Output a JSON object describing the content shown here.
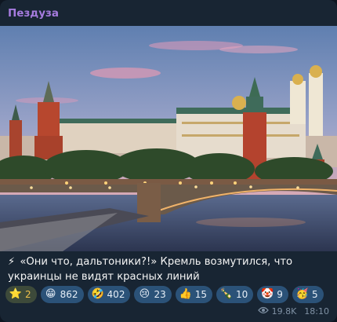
{
  "channel": {
    "name": "Пездуза"
  },
  "post": {
    "caption_icon": "⚡",
    "caption": "«Они что, дальтоники?!» Кремль возмутился, что украинцы не видят красных линий"
  },
  "reactions": [
    {
      "icon": "star-icon",
      "glyph": "⭐",
      "count": "2"
    },
    {
      "icon": "grinning-face-icon",
      "glyph": "😁",
      "count": "862"
    },
    {
      "icon": "rofl-face-icon",
      "glyph": "🤣",
      "count": "402"
    },
    {
      "icon": "crying-face-icon",
      "glyph": "😢",
      "count": "23"
    },
    {
      "icon": "thumbs-up-icon",
      "glyph": "👍",
      "count": "15"
    },
    {
      "icon": "champagne-icon",
      "glyph": "🍾",
      "count": "10"
    },
    {
      "icon": "clown-face-icon",
      "glyph": "🤡",
      "count": "9"
    },
    {
      "icon": "party-face-icon",
      "glyph": "🥳",
      "count": "5"
    }
  ],
  "meta": {
    "views": "19.8K",
    "time": "18:10"
  },
  "colors": {
    "channel_name": "#a57bde",
    "bubble": "#182533",
    "reaction_chip": "#2b5278"
  }
}
